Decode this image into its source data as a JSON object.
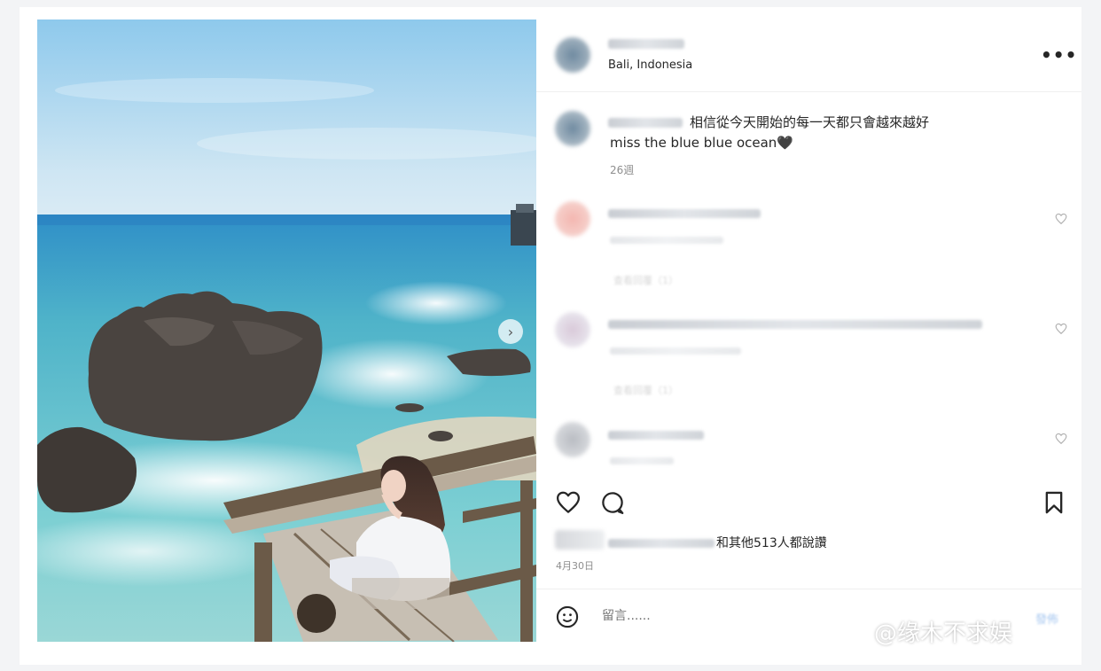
{
  "post": {
    "location": "Bali, Indonesia",
    "more_icon": "•••"
  },
  "caption": {
    "line1": "相信從今天開始的每一天都只會越來越好",
    "line2": "miss the blue blue ocean🖤",
    "age": "26週"
  },
  "comments": [
    {
      "reply_hint": "查看回覆（1）"
    },
    {
      "reply_hint": "查看回覆（1）"
    },
    {}
  ],
  "actions": {
    "like_icon": "heart-outline",
    "comment_icon": "speech-bubble",
    "save_icon": "bookmark"
  },
  "likes": {
    "text": "和其他513人都說讚"
  },
  "date": "4月30日",
  "comment_box": {
    "placeholder": "留言......",
    "post_label": "發佈"
  },
  "watermark": "@缘木不求娱",
  "colors": {
    "sky_top": "#8ec9ec",
    "sea": "#4fb3c9",
    "rock": "#4a4440",
    "panel_bg": "#ffffff"
  }
}
